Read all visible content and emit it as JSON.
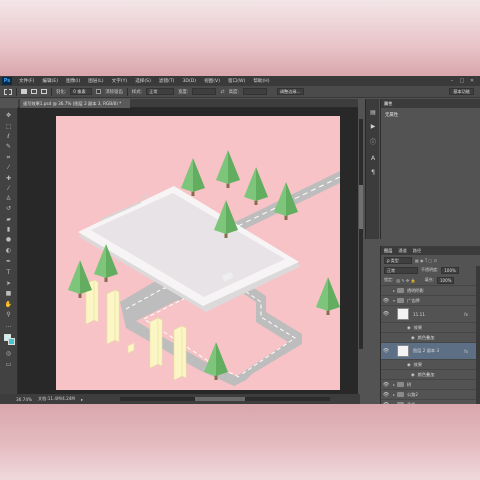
{
  "app": {
    "logo": "Ps",
    "menu": [
      "文件(F)",
      "编辑(E)",
      "图像(I)",
      "图层(L)",
      "文字(Y)",
      "选择(S)",
      "滤镜(T)",
      "3D(D)",
      "视图(V)",
      "窗口(W)",
      "帮助(H)"
    ],
    "window_controls": [
      "–",
      "□",
      "✕"
    ]
  },
  "options_bar": {
    "feather_label": "羽化:",
    "feather_value": "0 像素",
    "antialias_label": "消除锯齿",
    "style_label": "样式:",
    "style_value": "正常",
    "width_label": "宽度:",
    "height_label": "高度:",
    "refine_edge": "调整边缘...",
    "workspace": "基本功能"
  },
  "document": {
    "tab_title": "速写效果1.psd @ 36.7% (图层 2 副本 3, RGB/8) *",
    "zoom": "36.74%",
    "doc_size": "文档:11.4M/4.24M"
  },
  "colors": {
    "artboard_bg": "#f7c3c6",
    "ui_dark": "#535353",
    "tree_green": "#7cc57a",
    "trunk": "#8a6b4e",
    "road": "#bdbdbd",
    "phone": "#ffffff",
    "digits": "#fbf6c4"
  },
  "properties_panel": {
    "tabs": [
      "属性"
    ],
    "body": "无属性"
  },
  "layers_panel": {
    "tabs": [
      "图层",
      "通道",
      "路径"
    ],
    "filter": "ρ 类型",
    "blend_mode": "正常",
    "opacity_label": "不透明度:",
    "opacity": "100%",
    "lock_label": "锁定:",
    "fill_label": "填充:",
    "fill": "100%",
    "layers": [
      {
        "name": "透明阴影",
        "type": "folder"
      },
      {
        "name": "广告牌",
        "type": "folder"
      },
      {
        "name": "11.11",
        "type": "layer",
        "fx": "fx"
      },
      {
        "name": "效果",
        "type": "effect"
      },
      {
        "name": "颜色叠加",
        "type": "effect-item"
      },
      {
        "name": "图层 2 副本 3",
        "type": "layer",
        "fx": "fx",
        "selected": true
      },
      {
        "name": "效果",
        "type": "effect"
      },
      {
        "name": "颜色叠加",
        "type": "effect-item"
      },
      {
        "name": "树",
        "type": "folder"
      },
      {
        "name": "公路2",
        "type": "folder"
      },
      {
        "name": "手机",
        "type": "folder"
      }
    ]
  },
  "tools": [
    "move-tool",
    "marquee-tool",
    "lasso-tool",
    "quick-select-tool",
    "crop-tool",
    "eyedropper-tool",
    "healing-tool",
    "brush-tool",
    "clone-tool",
    "history-brush-tool",
    "eraser-tool",
    "gradient-tool",
    "blur-tool",
    "dodge-tool",
    "pen-tool",
    "type-tool",
    "path-select-tool",
    "shape-tool",
    "hand-tool",
    "zoom-tool"
  ]
}
